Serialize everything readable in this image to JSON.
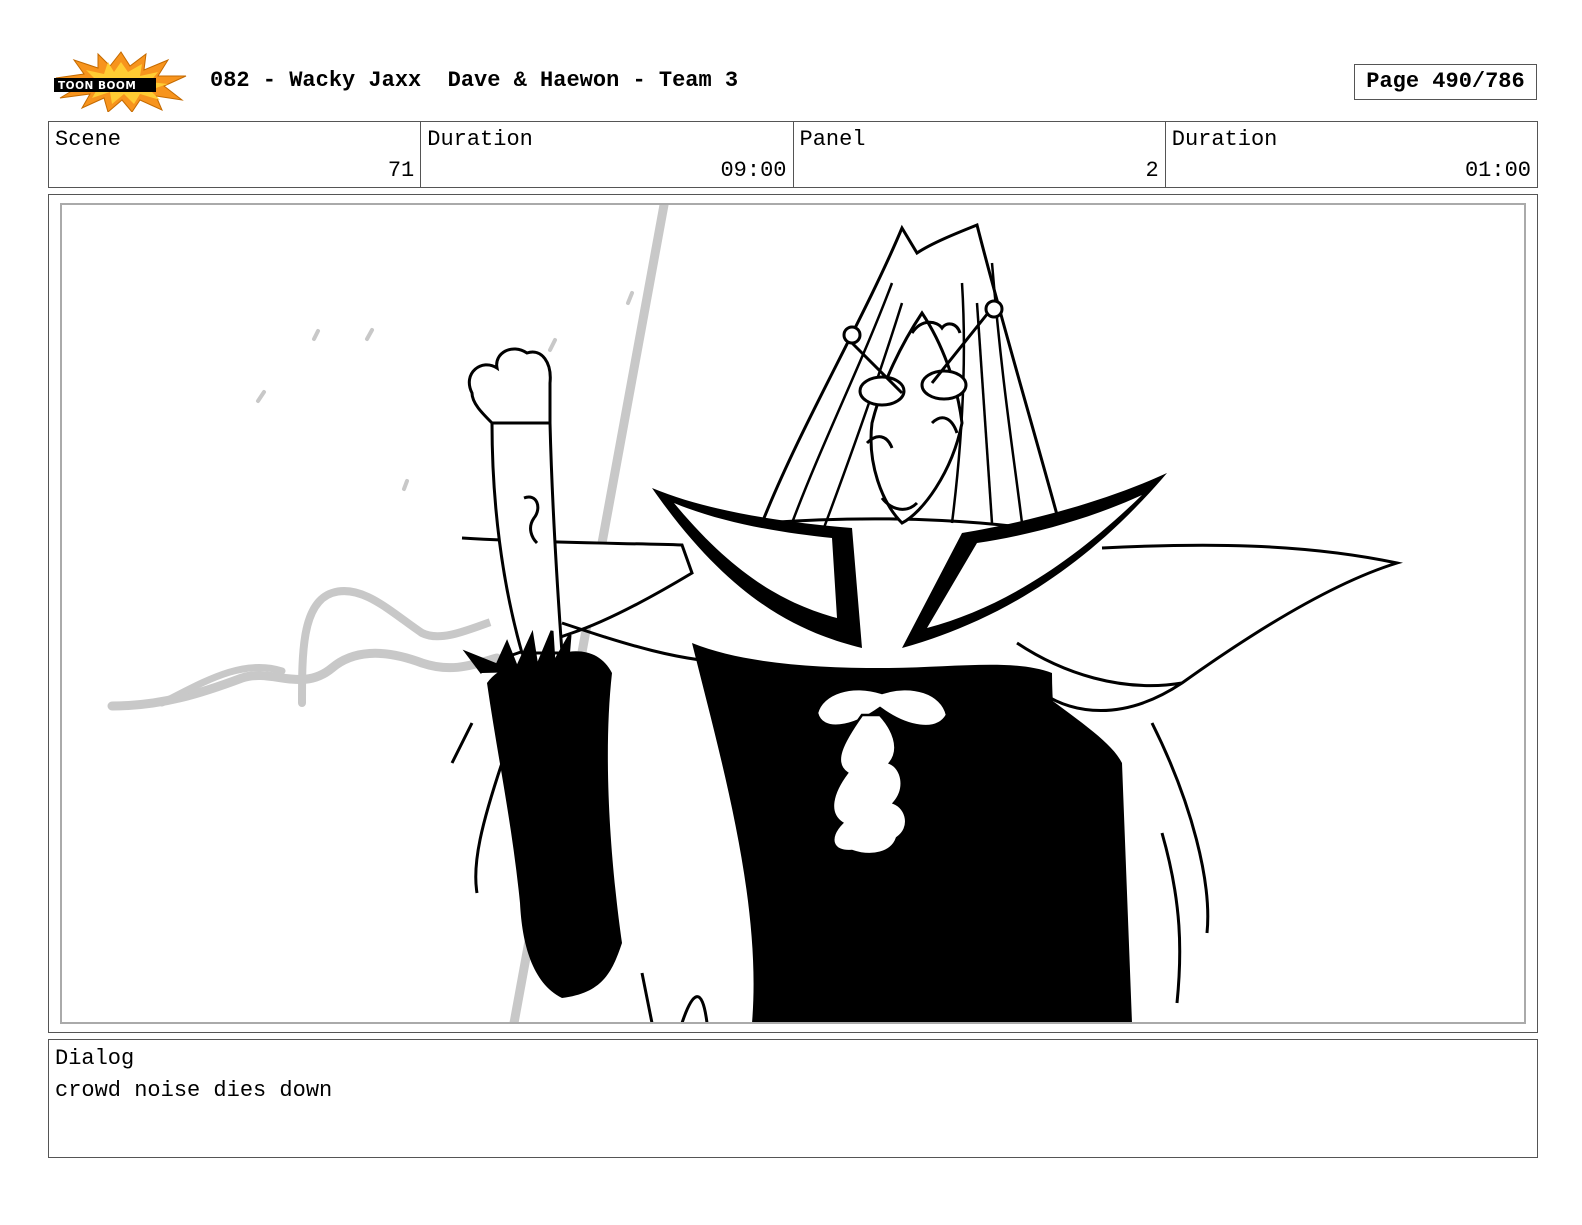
{
  "header": {
    "logo_text": "TOON BOOM",
    "title": "082 - Wacky Jaxx  Dave & Haewon - Team 3",
    "page": "Page 490/786"
  },
  "info": {
    "scene_label": "Scene",
    "scene_value": "71",
    "scene_duration_label": "Duration",
    "scene_duration_value": "09:00",
    "panel_label": "Panel",
    "panel_value": "2",
    "panel_duration_label": "Duration",
    "panel_duration_value": "01:00"
  },
  "dialog": {
    "label": "Dialog",
    "text": "crowd noise dies down"
  },
  "colors": {
    "logo_burst": "#f7941d",
    "logo_burst_inner": "#ffcc33",
    "guide_gray": "#c8c8c8"
  }
}
